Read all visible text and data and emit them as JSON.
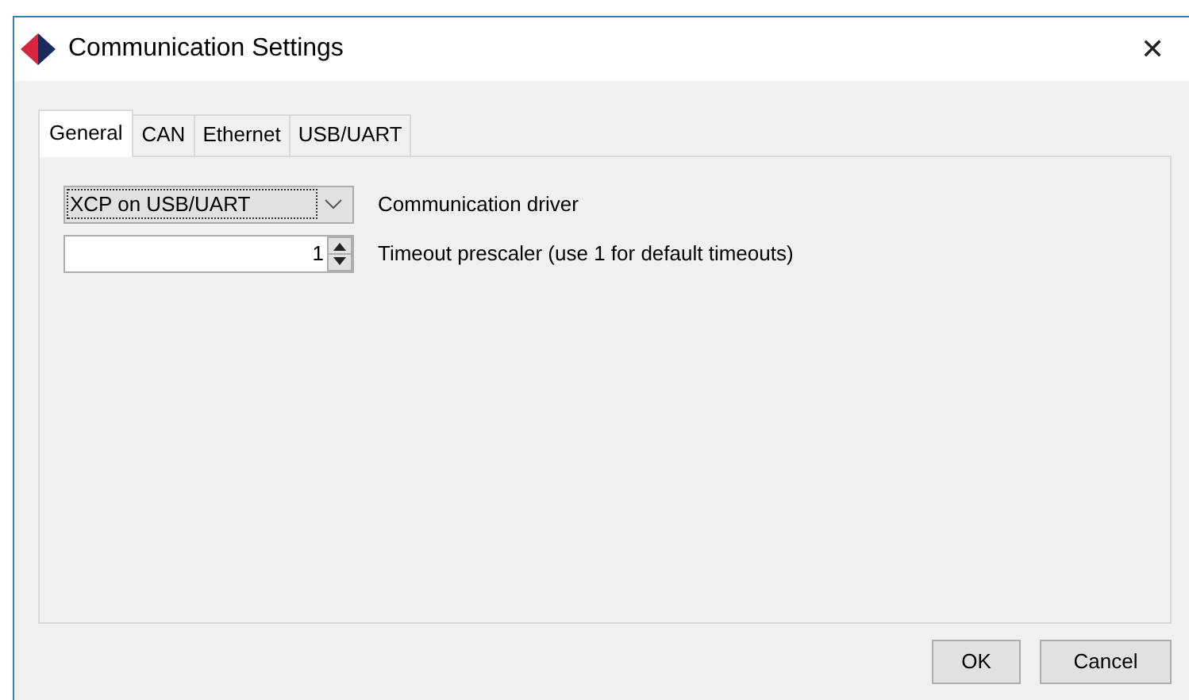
{
  "window": {
    "title": "Communication Settings",
    "close": "✕"
  },
  "tabs": [
    {
      "label": "General",
      "selected": true
    },
    {
      "label": "CAN",
      "selected": false
    },
    {
      "label": "Ethernet",
      "selected": false
    },
    {
      "label": "USB/UART",
      "selected": false
    }
  ],
  "driver": {
    "value": "XCP on USB/UART",
    "label": "Communication driver"
  },
  "prescaler": {
    "value": "1",
    "label": "Timeout prescaler (use 1 for default timeouts)"
  },
  "buttons": [
    "OK",
    "Cancel"
  ]
}
